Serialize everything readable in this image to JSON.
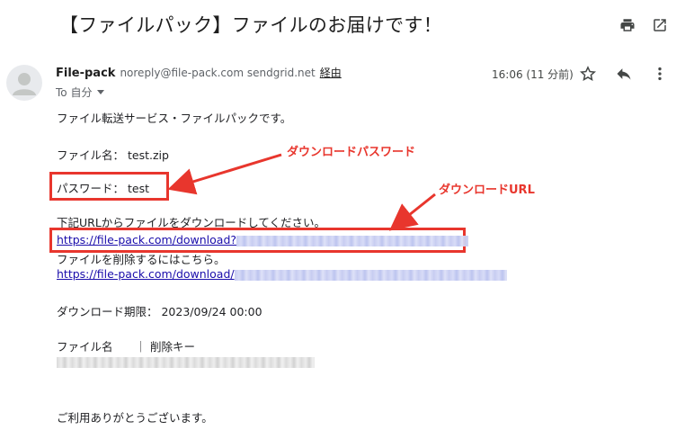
{
  "email": {
    "subject": "【ファイルパック】ファイルのお届けです！",
    "sender_name": "File-pack",
    "sender_email": "noreply@file-pack.com sendgrid.net",
    "via_label": "経由",
    "to_label": "To 自分",
    "time": "16:06 (11 分前)"
  },
  "icons": {
    "print": "print-icon",
    "open_new": "open-in-new-icon",
    "star": "star-icon",
    "reply": "reply-icon",
    "more": "more-vert-icon",
    "avatar": "person-icon"
  },
  "body": {
    "intro": "ファイル転送サービス・ファイルパックです。",
    "file_name_line": "ファイル名： test.zip",
    "password_line": "パスワード： test",
    "download_intro": "下記URLからファイルをダウンロードしてください。",
    "download_link": "https://file-pack.com/download?",
    "delete_intro": "ファイルを削除するにはこちら。",
    "delete_link": "https://file-pack.com/download/",
    "deadline": "ダウンロード期限： 2023/09/24 00:00",
    "table_header": "ファイル名　　｜ 削除キー",
    "closing": "ご利用ありがとうございます。"
  },
  "annotations": {
    "password_label": "ダウンロードパスワード",
    "url_label": "ダウンロードURL",
    "color": "#e8362d"
  },
  "colors": {
    "link": "#1a0dab",
    "annotation_red": "#e8362d"
  }
}
